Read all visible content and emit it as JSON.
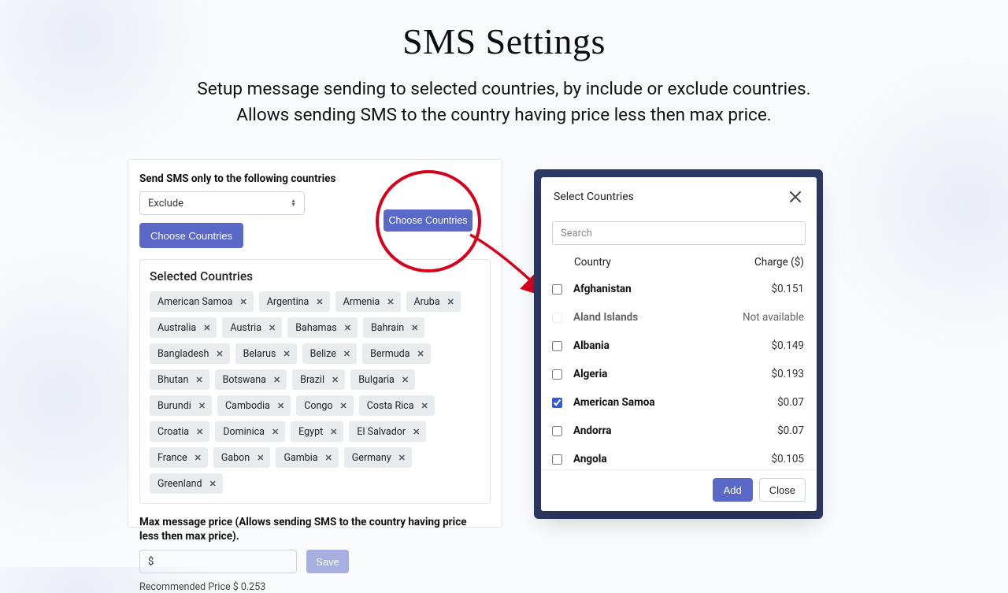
{
  "header": {
    "title": "SMS Settings",
    "subtitle_line1": "Setup message sending to selected countries, by include or exclude countries.",
    "subtitle_line2": "Allows sending SMS to the country having price less then max price."
  },
  "settings": {
    "section_label": "Send SMS only to the following countries",
    "mode": "Exclude",
    "choose_label": "Choose Countries",
    "selected_heading": "Selected Countries",
    "selected": [
      "American Samoa",
      "Argentina",
      "Armenia",
      "Aruba",
      "Australia",
      "Austria",
      "Bahamas",
      "Bahrain",
      "Bangladesh",
      "Belarus",
      "Belize",
      "Bermuda",
      "Bhutan",
      "Botswana",
      "Brazil",
      "Bulgaria",
      "Burundi",
      "Cambodia",
      "Congo",
      "Costa Rica",
      "Croatia",
      "Dominica",
      "Egypt",
      "El Salvador",
      "France",
      "Gabon",
      "Gambia",
      "Germany",
      "Greenland"
    ],
    "max_price_label": "Max message price (Allows sending SMS to the country having price less then max price).",
    "price_placeholder": "$",
    "save_label": "Save",
    "recommended": "Recommended Price $ 0.253"
  },
  "highlight": {
    "choose_label": "Choose Countries"
  },
  "modal": {
    "title": "Select Countries",
    "search_placeholder": "Search",
    "col_country": "Country",
    "col_charge": "Charge ($)",
    "rows": [
      {
        "name": "Afghanistan",
        "charge": "$0.151",
        "checked": false,
        "available": true
      },
      {
        "name": "Aland Islands",
        "charge": "Not available",
        "checked": false,
        "available": false
      },
      {
        "name": "Albania",
        "charge": "$0.149",
        "checked": false,
        "available": true
      },
      {
        "name": "Algeria",
        "charge": "$0.193",
        "checked": false,
        "available": true
      },
      {
        "name": "American Samoa",
        "charge": "$0.07",
        "checked": true,
        "available": true
      },
      {
        "name": "Andorra",
        "charge": "$0.07",
        "checked": false,
        "available": true
      },
      {
        "name": "Angola",
        "charge": "$0.105",
        "checked": false,
        "available": true
      }
    ],
    "add_label": "Add",
    "close_label": "Close"
  }
}
